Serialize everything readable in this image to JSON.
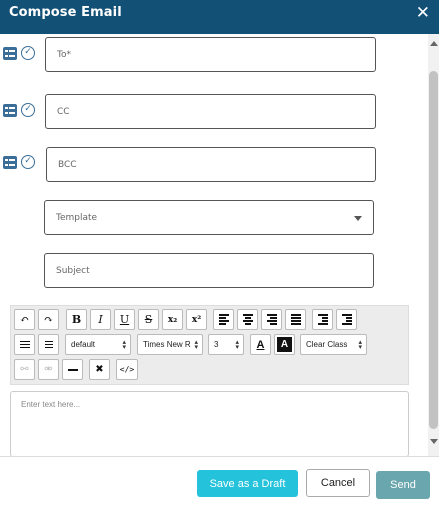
{
  "dialog": {
    "title": "Compose Email",
    "close_glyph": "✕"
  },
  "fields": {
    "to_placeholder": "To*",
    "cc_placeholder": "CC",
    "bcc_placeholder": "BCC",
    "template_placeholder": "Template",
    "subject_placeholder": "Subject"
  },
  "toolbar": {
    "undo": "↶",
    "redo": "↷",
    "bold": "B",
    "italic": "I",
    "underline": "U",
    "strike": "S",
    "subscript": "x₂",
    "superscript": "x²",
    "format_select": "default",
    "font_select": "Times New R",
    "size_select": "3",
    "font_color": "A",
    "bg_color": "A",
    "clear_class": "Clear Class",
    "code": "</>"
  },
  "editor": {
    "placeholder": "Enter text here..."
  },
  "buttons": {
    "draft": "Save as a Draft",
    "cancel": "Cancel",
    "send": "Send"
  },
  "colors": {
    "header": "#135076",
    "draft": "#25c2dc",
    "send": "#6aa6ad",
    "icon": "#3a6e98"
  }
}
